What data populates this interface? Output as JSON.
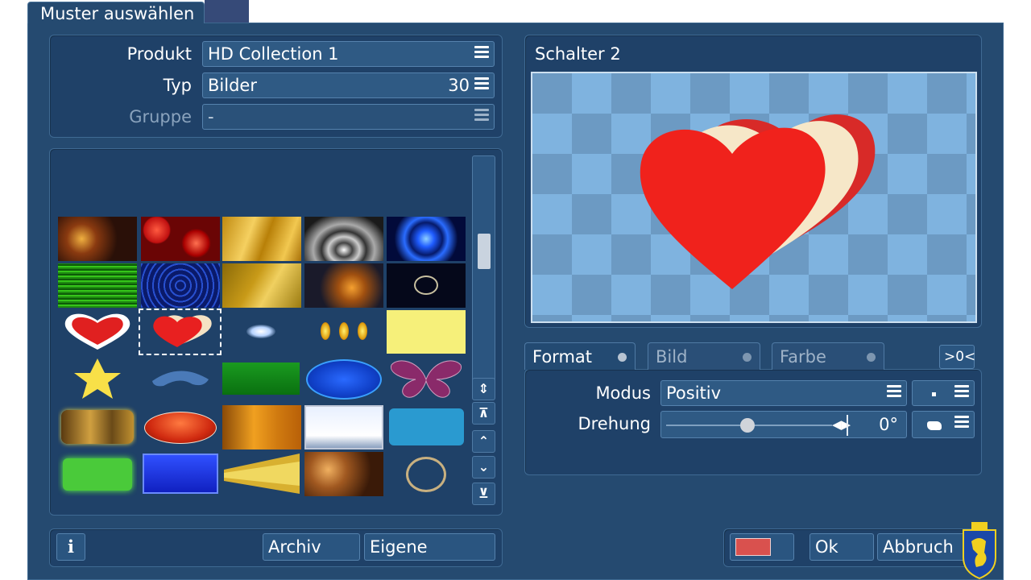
{
  "window": {
    "title": "Muster auswählen"
  },
  "fields": {
    "produkt_label": "Produkt",
    "produkt_value": "HD Collection 1",
    "typ_label": "Typ",
    "typ_value": "Bilder",
    "typ_count": "30",
    "gruppe_label": "Gruppe",
    "gruppe_value": "-"
  },
  "preview": {
    "title": "Schalter 2"
  },
  "tabs": {
    "format": "Format",
    "bild": "Bild",
    "farbe": "Farbe",
    "reset": ">0<"
  },
  "settings": {
    "modus_label": "Modus",
    "modus_value": "Positiv",
    "drehung_label": "Drehung",
    "drehung_value": "0°",
    "drehung_slider_fraction": 0.5
  },
  "buttons": {
    "info": "i",
    "archiv": "Archiv",
    "eigene": "Eigene",
    "ok": "Ok",
    "abbruch": "Abbruch"
  },
  "colors": {
    "window_bg": "#254a70",
    "panel_bg": "#1f4168",
    "color_swatch": "#d9514e",
    "heart_red": "#f0221c",
    "heart_cream": "#f6e7c8",
    "checker_light": "#7fb3df",
    "checker_dark": "#6c9ac3"
  },
  "icons": {
    "menu": "hamburger-menu-icon",
    "scroll_up_down": "updown-icon",
    "scroll_top": "scroll-top-icon",
    "scroll_up": "chevron-up-icon",
    "scroll_down": "chevron-down-icon",
    "scroll_bottom": "scroll-bottom-icon",
    "crest": "crest-logo-icon"
  }
}
